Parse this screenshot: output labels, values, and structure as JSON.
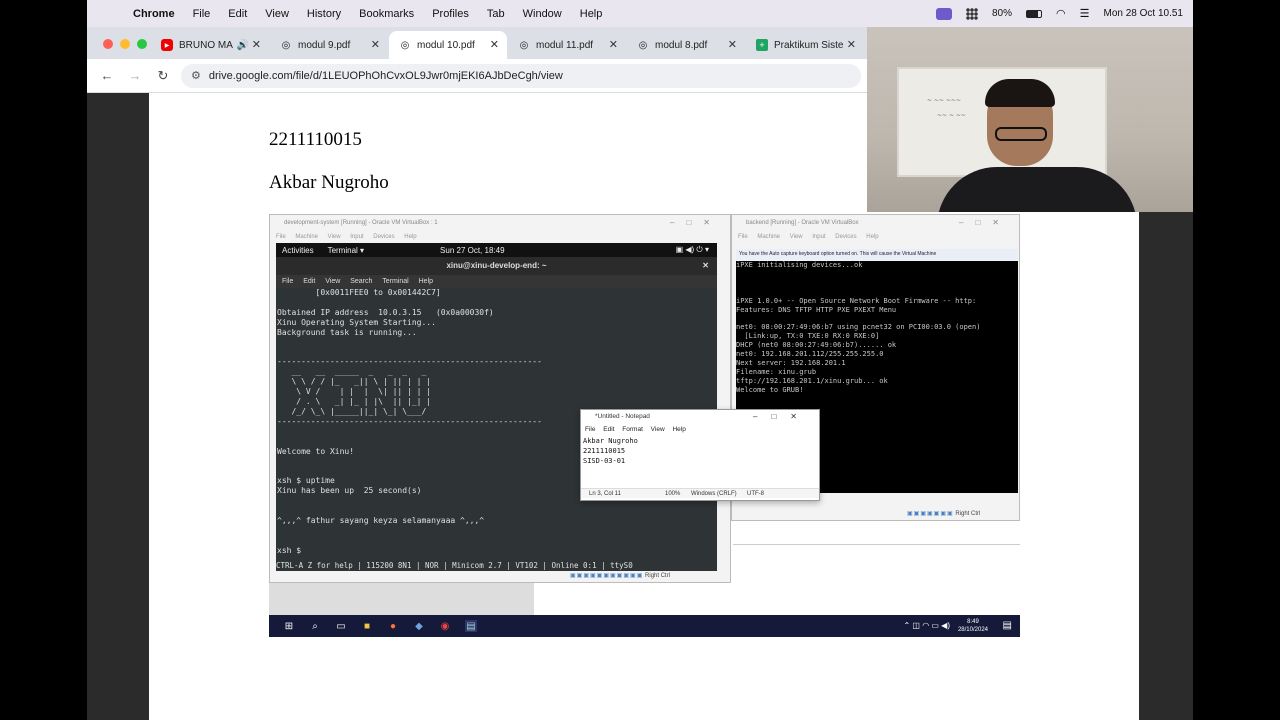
{
  "mac_menubar": {
    "app": "Chrome",
    "items": [
      "File",
      "Edit",
      "View",
      "History",
      "Bookmarks",
      "Profiles",
      "Tab",
      "Window",
      "Help"
    ],
    "battery": "80%",
    "datetime": "Mon 28 Oct  10.51"
  },
  "tabs": [
    {
      "label": "BRUNO MA",
      "icon": "youtube-icon"
    },
    {
      "label": "modul 9.pdf",
      "icon": "drive-icon"
    },
    {
      "label": "modul 10.pdf",
      "icon": "drive-icon"
    },
    {
      "label": "modul 11.pdf",
      "icon": "drive-icon"
    },
    {
      "label": "modul 8.pdf",
      "icon": "drive-icon"
    },
    {
      "label": "Praktikum Siste",
      "icon": "sheets-icon"
    }
  ],
  "address_bar": {
    "url": "drive.google.com/file/d/1LEUOPhOhCvxOL9Jwr0mjEKI6AJbDeCgh/view"
  },
  "document": {
    "student_id": "2211110015",
    "student_name": "Akbar Nugroho"
  },
  "vm_left": {
    "title": "development-system [Running] - Oracle VM VirtualBox : 1",
    "menu": "File  Machine  View  Input  Devices  Help",
    "gnome_activities": "Activities",
    "gnome_terminal": "Terminal ▾",
    "gnome_clock": "Sun 27 Oct, 18:49",
    "term_title": "xinu@xinu-develop-end: ~",
    "term_menu": "File Edit View Search Terminal Help",
    "console": "        [0x0011FEE0 to 0x001442C7]\n\nObtained IP address  10.0.3.15   (0x0a00030f)\nXinu Operating System Starting...\nBackground task is running...\n\n\n-------------------------------------------------------\n   __   __  _____  _   _  _   _\n   \\ \\ / / |_   _|| \\ | || | | |\n    \\ V /    | |  |  \\| || | | |\n    / . \\   _| |_ | |\\  || |_| |\n   /_/ \\_\\ |_____||_| \\_| \\___/\n-------------------------------------------------------\n\n\nWelcome to Xinu!\n\n\nxsh $ uptime\nXinu has been up  25 second(s)\n\n\n^,,,^ fathur sayang keyza selamanyaaa ^,,,^\n\n\nxsh $ ",
    "minicom_status": "CTRL-A Z for help | 115200 8N1 | NOR | Minicom 2.7 | VT102 | Online 0:1 | ttyS0",
    "host_key": "Right Ctrl"
  },
  "vm_right": {
    "title": "backend [Running] - Oracle VM VirtualBox",
    "menu": "File  Machine  View  Input  Devices  Help",
    "notice": "You have the Auto capture keyboard option turned on. This will cause the Virtual Machine",
    "console": "iPXE initialising devices...ok\n\n\n\niPXE 1.0.0+ -- Open Source Network Boot Firmware -- http:\nFeatures: DNS TFTP HTTP PXE PXEXT Menu\n\nnet0: 08:00:27:49:06:b7 using pcnet32 on PCI00:03.0 (open)\n  [Link:up, TX:0 TXE:0 RX:0 RXE:0]\nDHCP (net0 08:00:27:49:06:b7)...... ok\nnet0: 192.168.201.112/255.255.255.0\nNext server: 192.168.201.1\nFilename: xinu.grub\ntftp://192.168.201.1/xinu.grub... ok\nWelcome to GRUB!",
    "host_key": "Right Ctrl"
  },
  "notepad": {
    "title": "*Untitled - Notepad",
    "menu": "File  Edit  Format  View  Help",
    "content": "Akbar Nugroho\n2211110015\nSISD-03-01",
    "status_pos": "Ln 3, Col 11",
    "status_zoom": "100%",
    "status_eol": "Windows (CRLF)",
    "status_enc": "UTF-8"
  },
  "windows_taskbar": {
    "time": "8:49",
    "date": "28/10/2024"
  }
}
